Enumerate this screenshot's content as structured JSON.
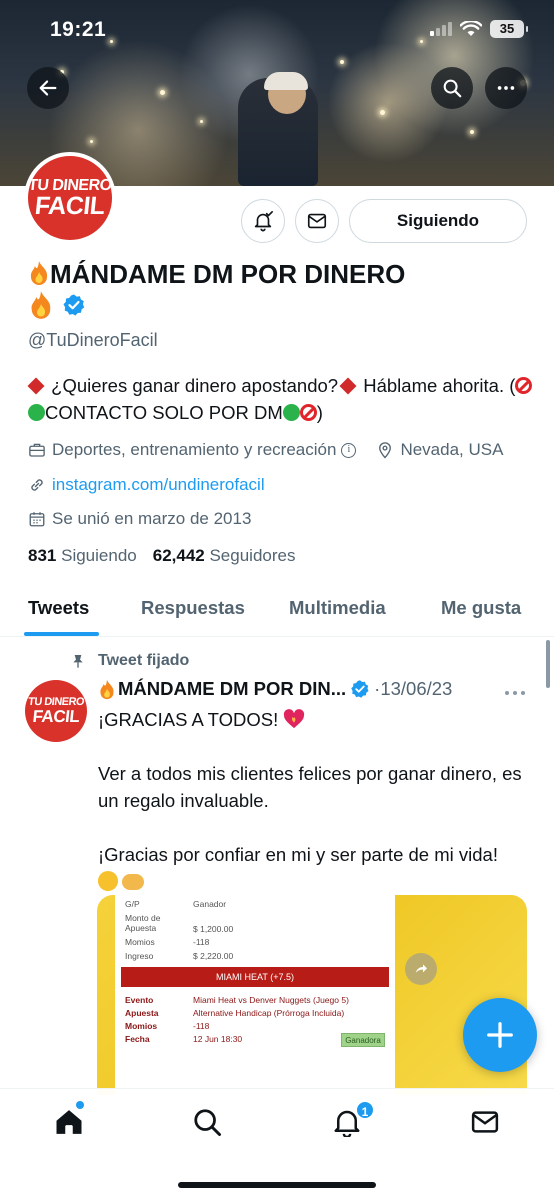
{
  "status_bar": {
    "time": "19:21",
    "battery": "35"
  },
  "profile": {
    "avatar_line1": "TU DINERO",
    "avatar_line2": "FACIL",
    "follow_label": "Siguiendo",
    "display_name": "MÁNDAME DM POR DINERO",
    "handle": "@TuDineroFacil",
    "bio_part1": "¿Quieres ganar dinero apostando?",
    "bio_part2": " Háblame ahorita. (",
    "bio_part3": "CONTACTO SOLO POR DM",
    "bio_part4": ")",
    "category": "Deportes, entrenamiento y recreación",
    "location": "Nevada, USA",
    "website": "instagram.com/undinerofacil",
    "joined": "Se unió en marzo de 2013",
    "following_count": "831",
    "following_label": "Siguiendo",
    "followers_count": "62,442",
    "followers_label": "Seguidores"
  },
  "tabs": [
    "Tweets",
    "Respuestas",
    "Multimedia",
    "Me gusta"
  ],
  "tweet": {
    "pinned_label": "Tweet fijado",
    "author": "MÁNDAME DM POR DIN...",
    "date": "·13/06/23",
    "line1": "¡GRACIAS A TODOS!",
    "line2": "Ver a todos mis clientes felices por ganar dinero, es un regalo invaluable.",
    "line3": "¡Gracias por confiar en mi y ser parte de mi vida!"
  },
  "receipt": {
    "rows_top": [
      {
        "k": "G/P",
        "v": "Ganador"
      },
      {
        "k": "Monto de Apuesta",
        "v": "$ 1,200.00"
      },
      {
        "k": "Momios",
        "v": "-118"
      },
      {
        "k": "Ingreso",
        "v": "$ 2,220.00"
      }
    ],
    "banner": "MIAMI HEAT (+7.5)",
    "rows_bottom": [
      {
        "k": "Evento",
        "v": "Miami Heat vs Denver Nuggets (Juego 5)"
      },
      {
        "k": "Apuesta",
        "v": "Alternative Handicap (Prórroga Incluida)"
      },
      {
        "k": "Momios",
        "v": "-118"
      },
      {
        "k": "Fecha",
        "v": "12 Jun 18:30"
      }
    ],
    "result": "Ganadora"
  },
  "bottom_nav": {
    "notifications_badge": "1"
  },
  "colors": {
    "accent": "#1d9bf0",
    "text_secondary": "#536471",
    "brand_red": "#d8322b"
  }
}
